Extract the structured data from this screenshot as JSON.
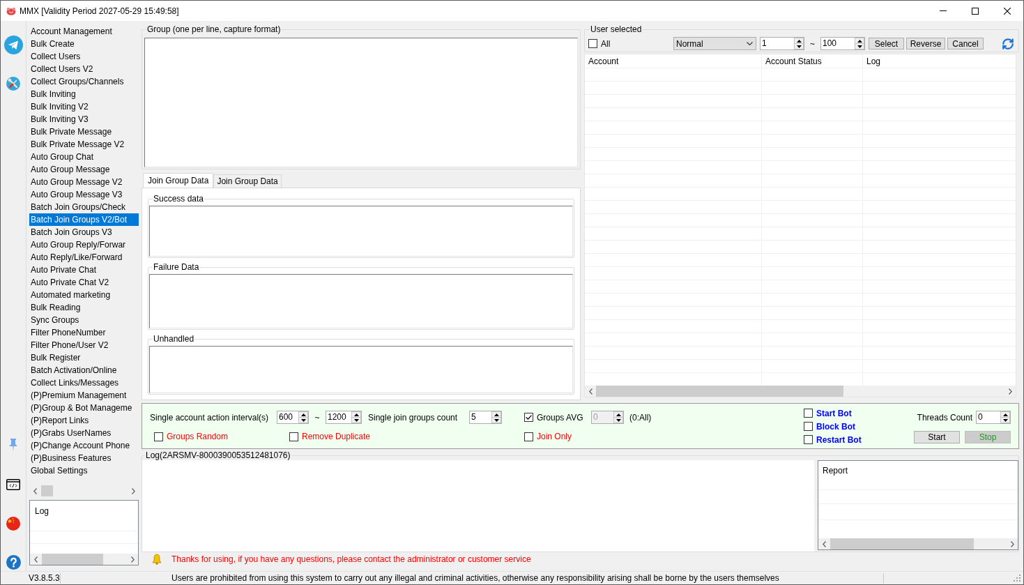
{
  "window": {
    "title": "MMX [Validity Period 2027-05-29 15:49:58]"
  },
  "menu": {
    "items": [
      {
        "label": "Account Management",
        "selected": false
      },
      {
        "label": "Bulk Create",
        "selected": false
      },
      {
        "label": "Collect Users",
        "selected": false
      },
      {
        "label": "Collect Users V2",
        "selected": false
      },
      {
        "label": "Collect Groups/Channels",
        "selected": false
      },
      {
        "label": "Bulk Inviting",
        "selected": false
      },
      {
        "label": "Bulk Inviting V2",
        "selected": false
      },
      {
        "label": "Bulk Inviting V3",
        "selected": false
      },
      {
        "label": "Bulk Private Message",
        "selected": false
      },
      {
        "label": "Bulk Private Message V2",
        "selected": false
      },
      {
        "label": "Auto Group Chat",
        "selected": false
      },
      {
        "label": "Auto Group Message",
        "selected": false
      },
      {
        "label": "Auto Group Message V2",
        "selected": false
      },
      {
        "label": "Auto Group Message V3",
        "selected": false
      },
      {
        "label": "Batch Join Groups/Check",
        "selected": false
      },
      {
        "label": "Batch Join Groups V2/Bot",
        "selected": true
      },
      {
        "label": "Batch Join Groups V3",
        "selected": false
      },
      {
        "label": "Auto Group Reply/Forwar",
        "selected": false
      },
      {
        "label": "Auto Reply/Like/Forward",
        "selected": false
      },
      {
        "label": "Auto Private Chat",
        "selected": false
      },
      {
        "label": "Auto Private Chat V2",
        "selected": false
      },
      {
        "label": "Automated marketing",
        "selected": false
      },
      {
        "label": "Bulk Reading",
        "selected": false
      },
      {
        "label": "Sync Groups",
        "selected": false
      },
      {
        "label": "Filter PhoneNumber",
        "selected": false
      },
      {
        "label": "Filter Phone/User V2",
        "selected": false
      },
      {
        "label": "Bulk Register",
        "selected": false
      },
      {
        "label": "Batch Activation/Online",
        "selected": false
      },
      {
        "label": "Collect Links/Messages",
        "selected": false
      },
      {
        "label": "(P)Premium Management",
        "selected": false
      },
      {
        "label": "(P)Group & Bot Manageme",
        "selected": false
      },
      {
        "label": "(P)Report Links",
        "selected": false
      },
      {
        "label": "(P)Grabs UserNames",
        "selected": false
      },
      {
        "label": "(P)Change Account Phone",
        "selected": false
      },
      {
        "label": "(P)Business Features",
        "selected": false
      },
      {
        "label": "Global Settings",
        "selected": false
      }
    ]
  },
  "menu_log": {
    "header": "Log"
  },
  "group_input": {
    "label": "Group (one per line, capture format)"
  },
  "tabs": [
    {
      "label": "Join Group Data",
      "selected": true
    },
    {
      "label": "Join Group Data",
      "selected": false
    }
  ],
  "result_boxes": [
    {
      "label": "Success data"
    },
    {
      "label": "Failure Data"
    },
    {
      "label": "Unhandled"
    }
  ],
  "user_selected": {
    "label": "User selected",
    "all": {
      "label": "All",
      "checked": false
    },
    "mode": "Normal",
    "range_from": "1",
    "range_separator": "~",
    "range_to": "100",
    "buttons": [
      {
        "label": "Select"
      },
      {
        "label": "Reverse"
      },
      {
        "label": "Cancel"
      }
    ]
  },
  "accounts_table": {
    "columns": [
      "Account",
      "Account Status",
      "Log"
    ]
  },
  "settings": {
    "interval_label": "Single account action interval(s)",
    "interval_from": "600",
    "interval_separator": "~",
    "interval_to": "1200",
    "join_count_label": "Single join groups count",
    "join_count": "5",
    "avg_value": {
      "value": "0",
      "disabled": true
    },
    "avg_hint": "(0:All)",
    "checkboxes": [
      {
        "kind": "option",
        "label": "Groups AVG",
        "checked": true,
        "color": "#000000"
      },
      {
        "kind": "option",
        "label": "Groups Random",
        "checked": false,
        "color": "#ff0000"
      },
      {
        "kind": "option",
        "label": "Remove Duplicate",
        "checked": false,
        "color": "#ff0000"
      },
      {
        "kind": "option",
        "label": "Join Only",
        "checked": false,
        "color": "#ff0000"
      },
      {
        "kind": "bot",
        "label": "Start Bot",
        "checked": false,
        "color": "#0000ff"
      },
      {
        "kind": "bot",
        "label": "Block Bot",
        "checked": false,
        "color": "#0000ff"
      },
      {
        "kind": "bot",
        "label": "Restart Bot",
        "checked": false,
        "color": "#0000ff"
      }
    ],
    "threads_label": "Threads Count",
    "threads": "0",
    "buttons": [
      {
        "label": "Start",
        "disabled": false,
        "color": "#000000"
      },
      {
        "label": "Stop",
        "disabled": true,
        "color": "#1f9a1f"
      }
    ]
  },
  "log": {
    "label": "Log(2ARSMV-8000390053512481076)"
  },
  "report": {
    "header": "Report"
  },
  "notice": "Thanks for using, if you have any questions, please contact the administrator or customer service",
  "status_bar": {
    "version": "V3.8.5.3",
    "message": "Users are prohibited from using this system to carry out any illegal and criminal activities, otherwise any responsibility arising shall be borne by the users themselves"
  }
}
